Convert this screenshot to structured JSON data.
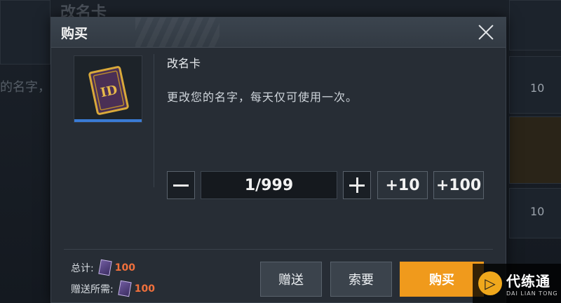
{
  "background": {
    "title": "改名卡",
    "snippet": "的名字，",
    "coin_values": [
      "10",
      "10"
    ]
  },
  "dialog": {
    "title": "购买",
    "item": {
      "name": "改名卡",
      "description": "更改您的名字，每天仅可使用一次。",
      "icon": "id-card-icon"
    },
    "quantity": {
      "value": "1/999",
      "add10_label": "+10",
      "add100_label": "+100"
    },
    "cost": {
      "total_label": "总计:",
      "total_value": "100",
      "gift_label": "赠送所需:",
      "gift_value": "100"
    },
    "buttons": {
      "gift": "赠送",
      "ask": "索要",
      "buy": "购买"
    }
  },
  "watermark": {
    "name": "代练通",
    "subtitle": "DAI LIAN TONG"
  },
  "colors": {
    "buy_accent": "#f09a1c",
    "cost_value": "#f0703c",
    "item_bar": "#3a7bd5"
  }
}
